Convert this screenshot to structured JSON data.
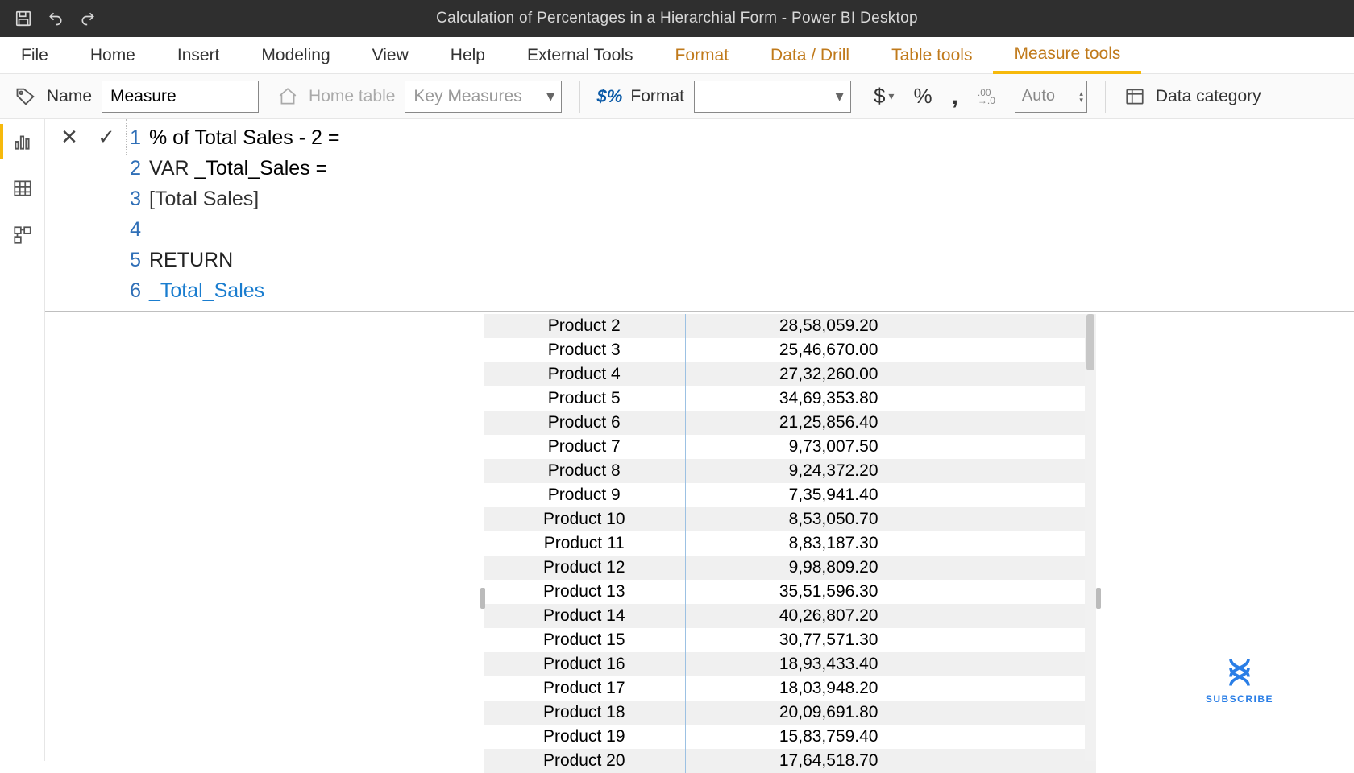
{
  "titlebar": {
    "title": "Calculation of Percentages in a Hierarchial Form - Power BI Desktop"
  },
  "tabs": {
    "file": "File",
    "home": "Home",
    "insert": "Insert",
    "modeling": "Modeling",
    "view": "View",
    "help": "Help",
    "external": "External Tools",
    "format": "Format",
    "datadrill": "Data / Drill",
    "tabletools": "Table tools",
    "measuretools": "Measure tools"
  },
  "ribbon": {
    "name_label": "Name",
    "name_value": "Measure",
    "home_table_label": "Home table",
    "home_table_value": "Key Measures",
    "format_label": "Format",
    "format_value": "",
    "auto_value": "Auto",
    "data_category_label": "Data category"
  },
  "formula": {
    "lines": {
      "l1": "% of Total Sales - 2 = ",
      "l2_var": "VAR",
      "l2_name": " _Total_Sales ",
      "l2_eq": "= ",
      "l3": "[Total Sales]",
      "l4": "",
      "l5": "RETURN",
      "l6": "_Total_Sales"
    }
  },
  "table": {
    "rows": [
      {
        "name": "Product 2",
        "value": "28,58,059.20"
      },
      {
        "name": "Product 3",
        "value": "25,46,670.00"
      },
      {
        "name": "Product 4",
        "value": "27,32,260.00"
      },
      {
        "name": "Product 5",
        "value": "34,69,353.80"
      },
      {
        "name": "Product 6",
        "value": "21,25,856.40"
      },
      {
        "name": "Product 7",
        "value": "9,73,007.50"
      },
      {
        "name": "Product 8",
        "value": "9,24,372.20"
      },
      {
        "name": "Product 9",
        "value": "7,35,941.40"
      },
      {
        "name": "Product 10",
        "value": "8,53,050.70"
      },
      {
        "name": "Product 11",
        "value": "8,83,187.30"
      },
      {
        "name": "Product 12",
        "value": "9,98,809.20"
      },
      {
        "name": "Product 13",
        "value": "35,51,596.30"
      },
      {
        "name": "Product 14",
        "value": "40,26,807.20"
      },
      {
        "name": "Product 15",
        "value": "30,77,571.30"
      },
      {
        "name": "Product 16",
        "value": "18,93,433.40"
      },
      {
        "name": "Product 17",
        "value": "18,03,948.20"
      },
      {
        "name": "Product 18",
        "value": "20,09,691.80"
      },
      {
        "name": "Product 19",
        "value": "15,83,759.40"
      },
      {
        "name": "Product 20",
        "value": "17,64,518.70"
      }
    ]
  },
  "subscribe": {
    "label": "SUBSCRIBE"
  }
}
